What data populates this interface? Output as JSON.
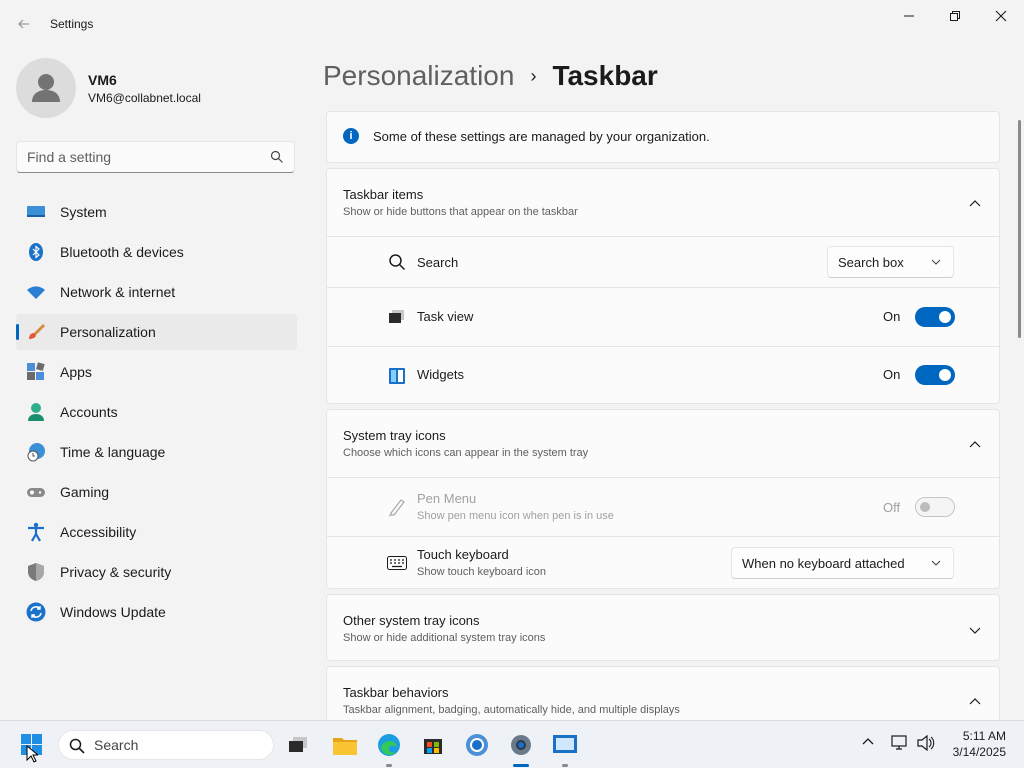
{
  "window": {
    "title": "Settings"
  },
  "profile": {
    "name": "VM6",
    "email": "VM6@collabnet.local"
  },
  "search": {
    "placeholder": "Find a setting"
  },
  "nav": [
    {
      "label": "System",
      "icon": "system-icon"
    },
    {
      "label": "Bluetooth & devices",
      "icon": "bluetooth-icon"
    },
    {
      "label": "Network & internet",
      "icon": "wifi-icon"
    },
    {
      "label": "Personalization",
      "icon": "paintbrush-icon",
      "active": true
    },
    {
      "label": "Apps",
      "icon": "apps-icon"
    },
    {
      "label": "Accounts",
      "icon": "accounts-icon"
    },
    {
      "label": "Time & language",
      "icon": "clock-globe-icon"
    },
    {
      "label": "Gaming",
      "icon": "gamepad-icon"
    },
    {
      "label": "Accessibility",
      "icon": "accessibility-icon"
    },
    {
      "label": "Privacy & security",
      "icon": "shield-icon"
    },
    {
      "label": "Windows Update",
      "icon": "update-icon"
    }
  ],
  "breadcrumb": {
    "parent": "Personalization",
    "separator": "›",
    "current": "Taskbar"
  },
  "notice": {
    "text": "Some of these settings are managed by your organization."
  },
  "taskbar_items": {
    "title": "Taskbar items",
    "subtitle": "Show or hide buttons that appear on the taskbar",
    "search": {
      "label": "Search",
      "value": "Search box"
    },
    "task_view": {
      "label": "Task view",
      "state": "On"
    },
    "widgets": {
      "label": "Widgets",
      "state": "On"
    }
  },
  "system_tray": {
    "title": "System tray icons",
    "subtitle": "Choose which icons can appear in the system tray",
    "pen_menu": {
      "label": "Pen Menu",
      "sub": "Show pen menu icon when pen is in use",
      "state": "Off"
    },
    "touch_keyboard": {
      "label": "Touch keyboard",
      "sub": "Show touch keyboard icon",
      "value": "When no keyboard attached"
    }
  },
  "other_tray": {
    "title": "Other system tray icons",
    "subtitle": "Show or hide additional system tray icons"
  },
  "behaviors": {
    "title": "Taskbar behaviors",
    "subtitle": "Taskbar alignment, badging, automatically hide, and multiple displays"
  },
  "taskbar": {
    "search_label": "Search",
    "time": "5:11 AM",
    "date": "3/14/2025"
  },
  "colors": {
    "accent": "#0067c0",
    "background": "#f3f3f3",
    "card": "#fbfbfb"
  }
}
